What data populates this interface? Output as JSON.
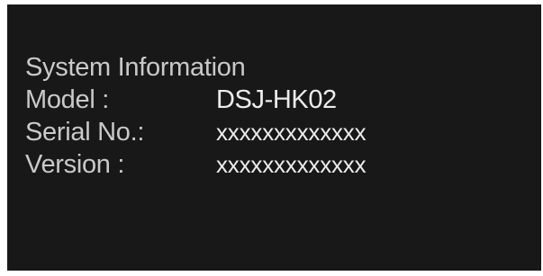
{
  "system_info": {
    "title": "System Information",
    "rows": [
      {
        "label": "Model :",
        "value": "DSJ-HK02"
      },
      {
        "label": "Serial No.:",
        "value": "xxxxxxxxxxxxx"
      },
      {
        "label": "Version :",
        "value": "xxxxxxxxxxxxx"
      }
    ]
  },
  "colors": {
    "background": "#181818",
    "label_text": "#c9c9c9",
    "value_text": "#ececec"
  }
}
